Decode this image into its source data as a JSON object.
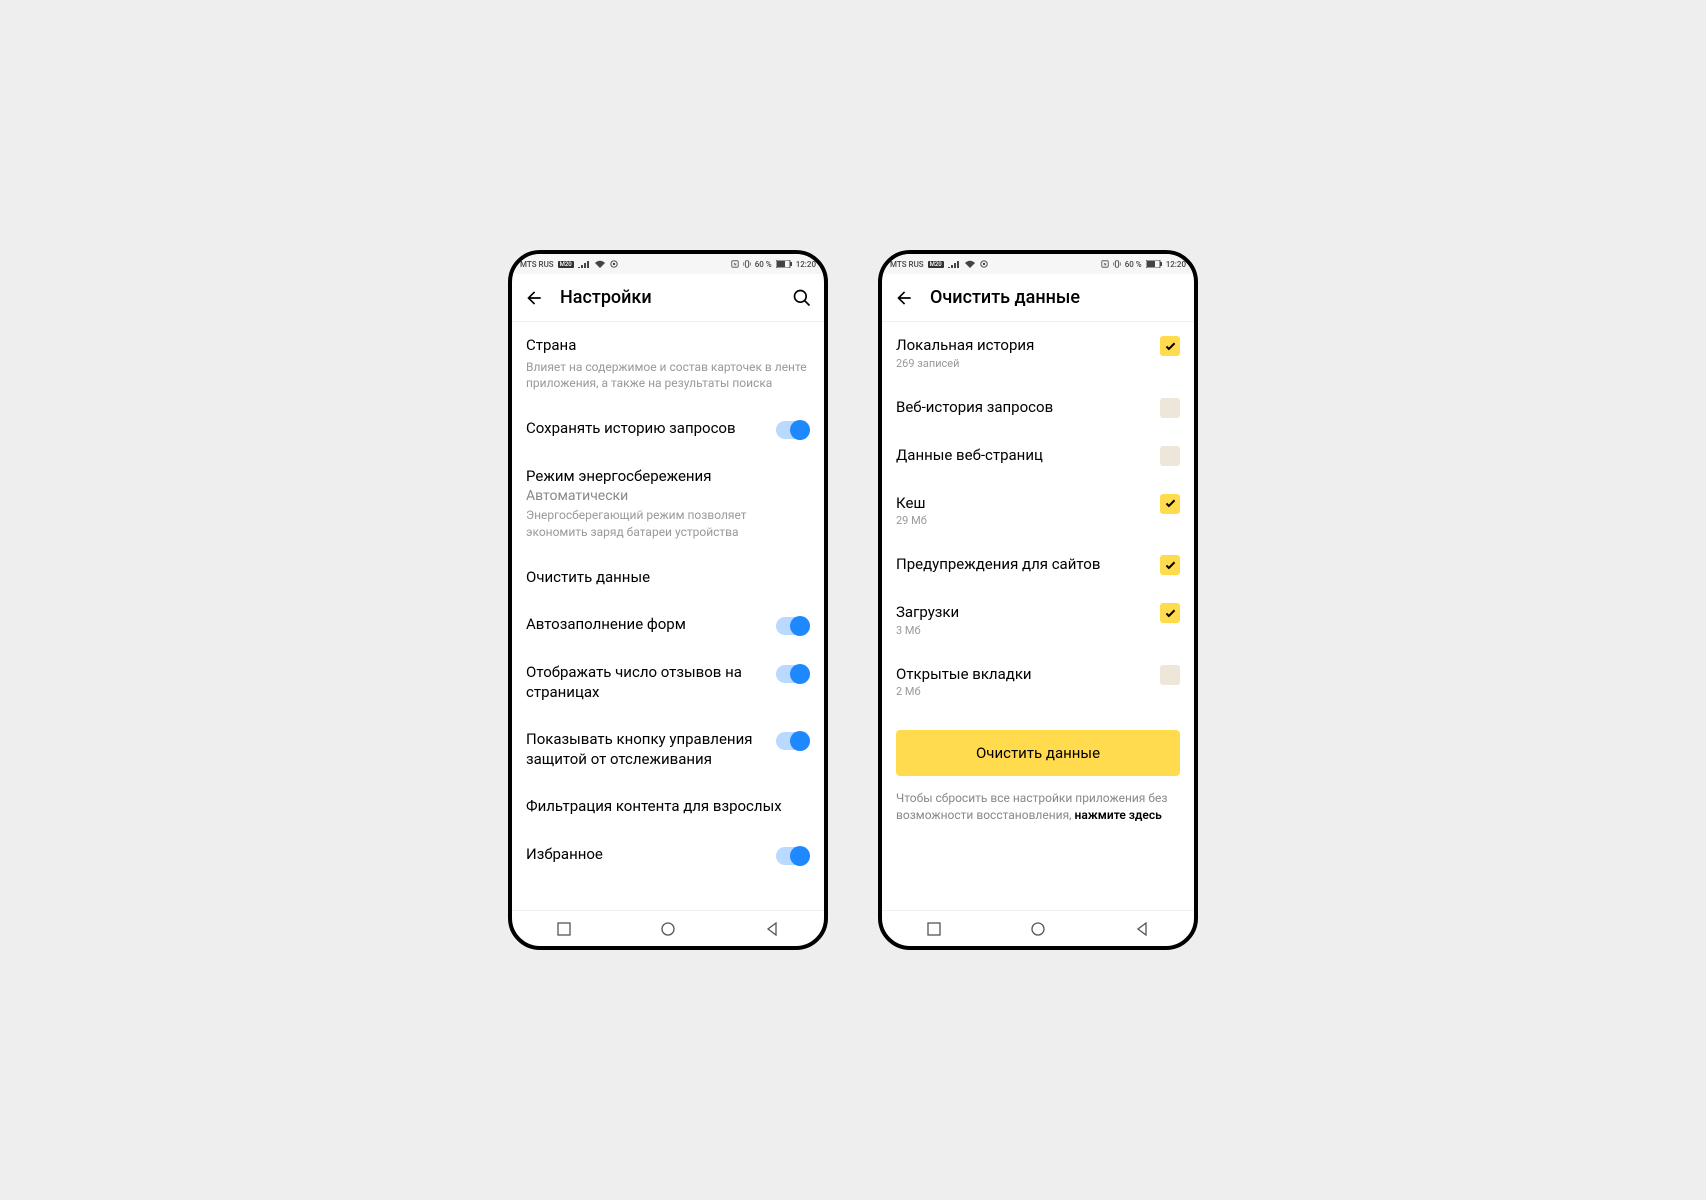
{
  "statusbar": {
    "carrier": "MTS RUS",
    "carrier_badge": "M20",
    "battery": "60 %",
    "time": "12:20"
  },
  "phone1": {
    "title": "Настройки",
    "rows": {
      "country": {
        "label": "Страна",
        "desc": "Влияет на содержимое и состав карточек в ленте приложения, а также на результаты поиска"
      },
      "save_history": {
        "label": "Сохранять историю запросов"
      },
      "power_mode": {
        "label": "Режим энергосбережения",
        "value": "Автоматически",
        "desc": "Энергосберегающий режим позволяет экономить заряд батареи устройства"
      },
      "clear_data": {
        "label": "Очистить данные"
      },
      "autofill": {
        "label": "Автозаполнение форм"
      },
      "reviews": {
        "label": "Отображать число отзывов на страницах"
      },
      "tracking": {
        "label": "Показывать кнопку управления защитой от отслеживания"
      },
      "adult": {
        "label": "Фильтрация контента для взрослых"
      },
      "favorites": {
        "label": "Избранное"
      }
    }
  },
  "phone2": {
    "title": "Очистить данные",
    "items": {
      "local_history": {
        "label": "Локальная история",
        "sub": "269 записей",
        "checked": true
      },
      "web_history": {
        "label": "Веб-история запросов",
        "checked": false
      },
      "page_data": {
        "label": "Данные веб-страниц",
        "checked": false
      },
      "cache": {
        "label": "Кеш",
        "sub": "29 Мб",
        "checked": true
      },
      "site_warnings": {
        "label": "Предупреждения для сайтов",
        "checked": true
      },
      "downloads": {
        "label": "Загрузки",
        "sub": "3 Мб",
        "checked": true
      },
      "open_tabs": {
        "label": "Открытые вкладки",
        "sub": "2 Мб",
        "checked": false
      }
    },
    "clear_button": "Очистить данные",
    "reset_note_1": "Чтобы сбросить все настройки приложения без возможности восстановления, ",
    "reset_note_2": "нажмите здесь"
  }
}
